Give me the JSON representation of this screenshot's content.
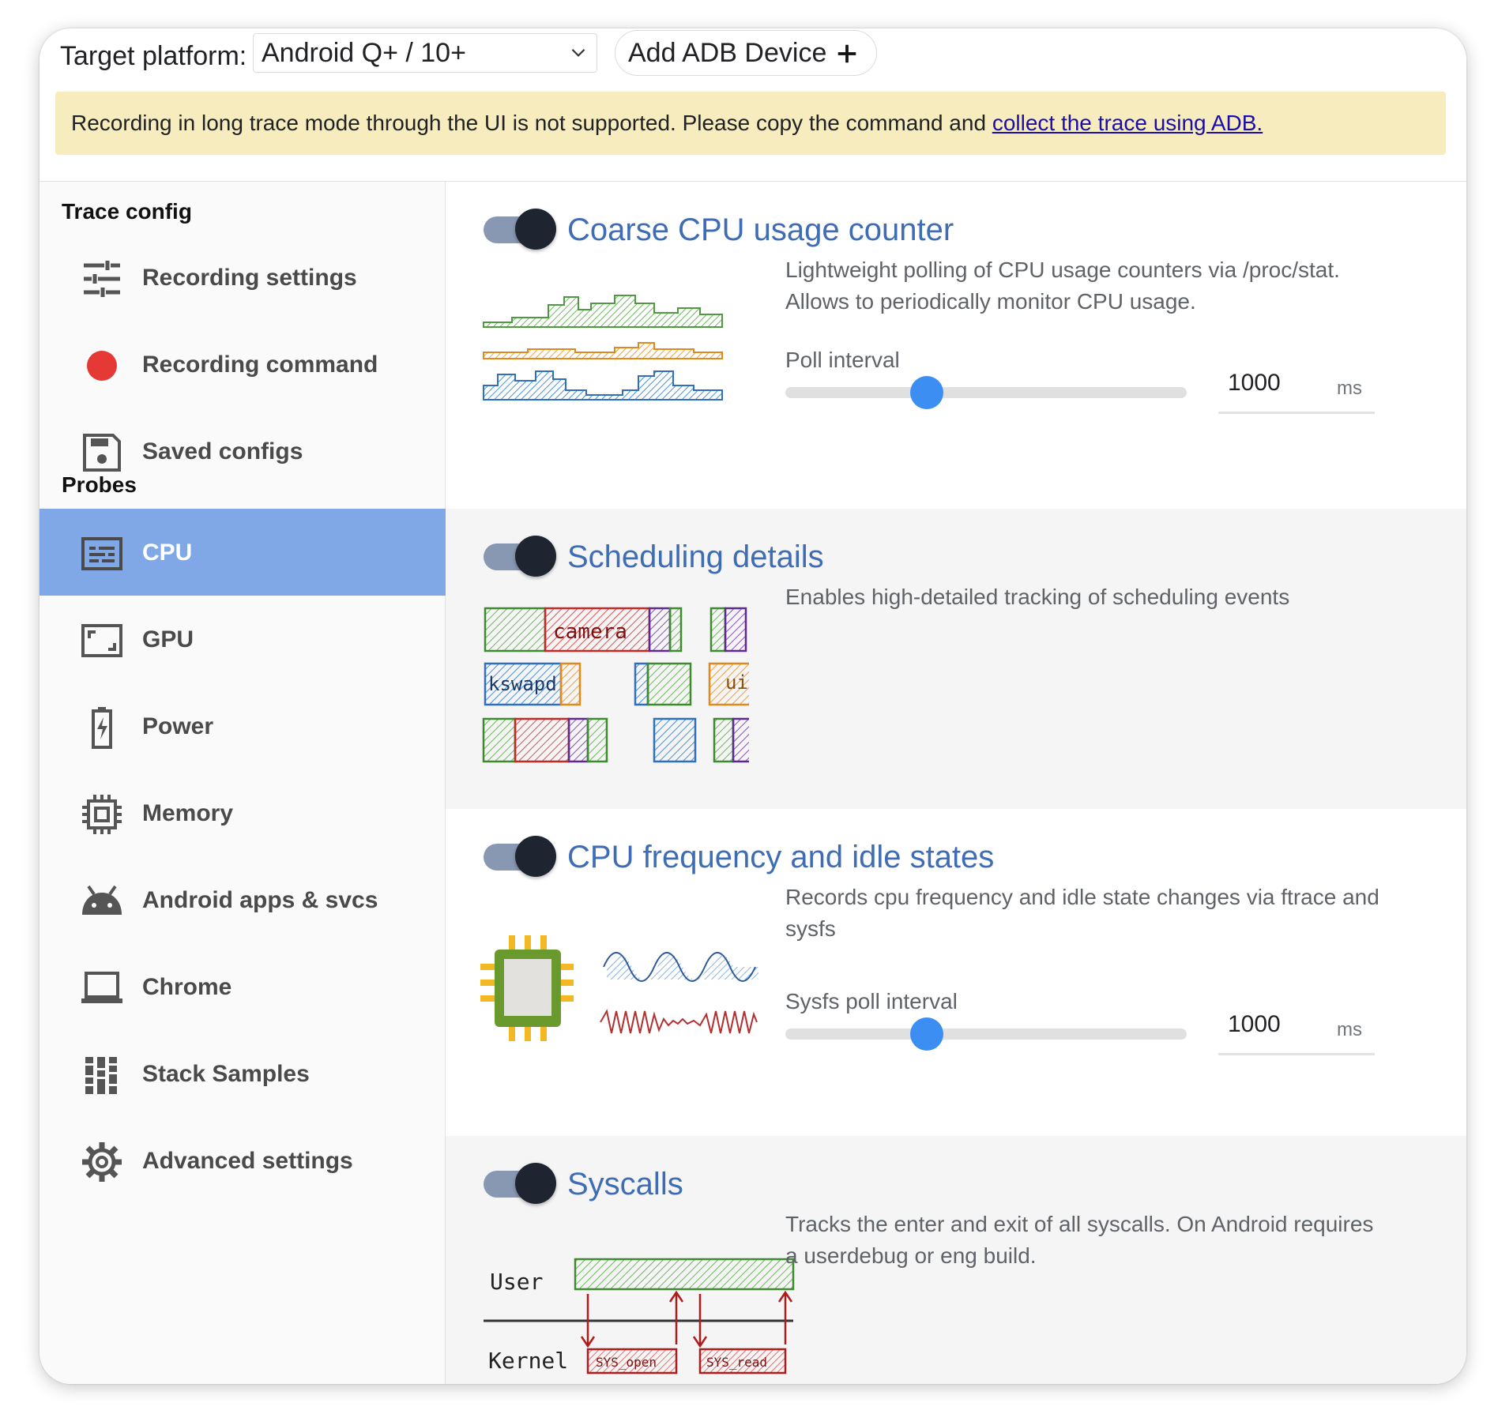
{
  "topbar": {
    "platform_label": "Target platform:",
    "platform_value": "Android Q+ / 10+",
    "add_device_label": "Add ADB Device",
    "warning_text": "Recording in long trace mode through the UI is not supported. Please copy the command and ",
    "warning_link": "collect the trace using ADB."
  },
  "sidebar": {
    "trace_config_heading": "Trace config",
    "probes_heading": "Probes",
    "config_items": [
      {
        "label": "Recording settings",
        "icon": "tune-icon"
      },
      {
        "label": "Recording command",
        "icon": "record-dot-icon"
      },
      {
        "label": "Saved configs",
        "icon": "save-icon"
      }
    ],
    "probe_items": [
      {
        "label": "CPU",
        "icon": "cpu-icon",
        "active": true
      },
      {
        "label": "GPU",
        "icon": "gpu-icon",
        "active": false
      },
      {
        "label": "Power",
        "icon": "battery-icon",
        "active": false
      },
      {
        "label": "Memory",
        "icon": "memory-chip-icon",
        "active": false
      },
      {
        "label": "Android apps & svcs",
        "icon": "android-icon",
        "active": false
      },
      {
        "label": "Chrome",
        "icon": "laptop-icon",
        "active": false
      },
      {
        "label": "Stack Samples",
        "icon": "stack-samples-icon",
        "active": false
      },
      {
        "label": "Advanced settings",
        "icon": "gear-icon",
        "active": false
      }
    ]
  },
  "probes": [
    {
      "title": "Coarse CPU usage counter",
      "enabled": true,
      "description": "Lightweight polling of CPU usage counters via /proc/stat. Allows to periodically monitor CPU usage.",
      "param_label": "Poll interval",
      "param_value": "1000",
      "param_unit": "ms"
    },
    {
      "title": "Scheduling details",
      "enabled": true,
      "description": "Enables high-detailed tracking of scheduling events",
      "illustration_labels": [
        "camera",
        "kswapd",
        "ui"
      ]
    },
    {
      "title": "CPU frequency and idle states",
      "enabled": true,
      "description": "Records cpu frequency and idle state changes via ftrace and sysfs",
      "param_label": "Sysfs poll interval",
      "param_value": "1000",
      "param_unit": "ms"
    },
    {
      "title": "Syscalls",
      "enabled": true,
      "description": "Tracks the enter and exit of all syscalls. On Android requires a userdebug or eng build.",
      "illustration_labels": [
        "User",
        "Kernel",
        "SYS_open",
        "SYS_read"
      ]
    }
  ],
  "colors": {
    "accent_blue": "#3e6db5",
    "active_item_bg": "#80a8e6",
    "warning_bg": "#f6ecbd",
    "slider_thumb": "#3d8ef2",
    "record_red": "#e53935"
  }
}
